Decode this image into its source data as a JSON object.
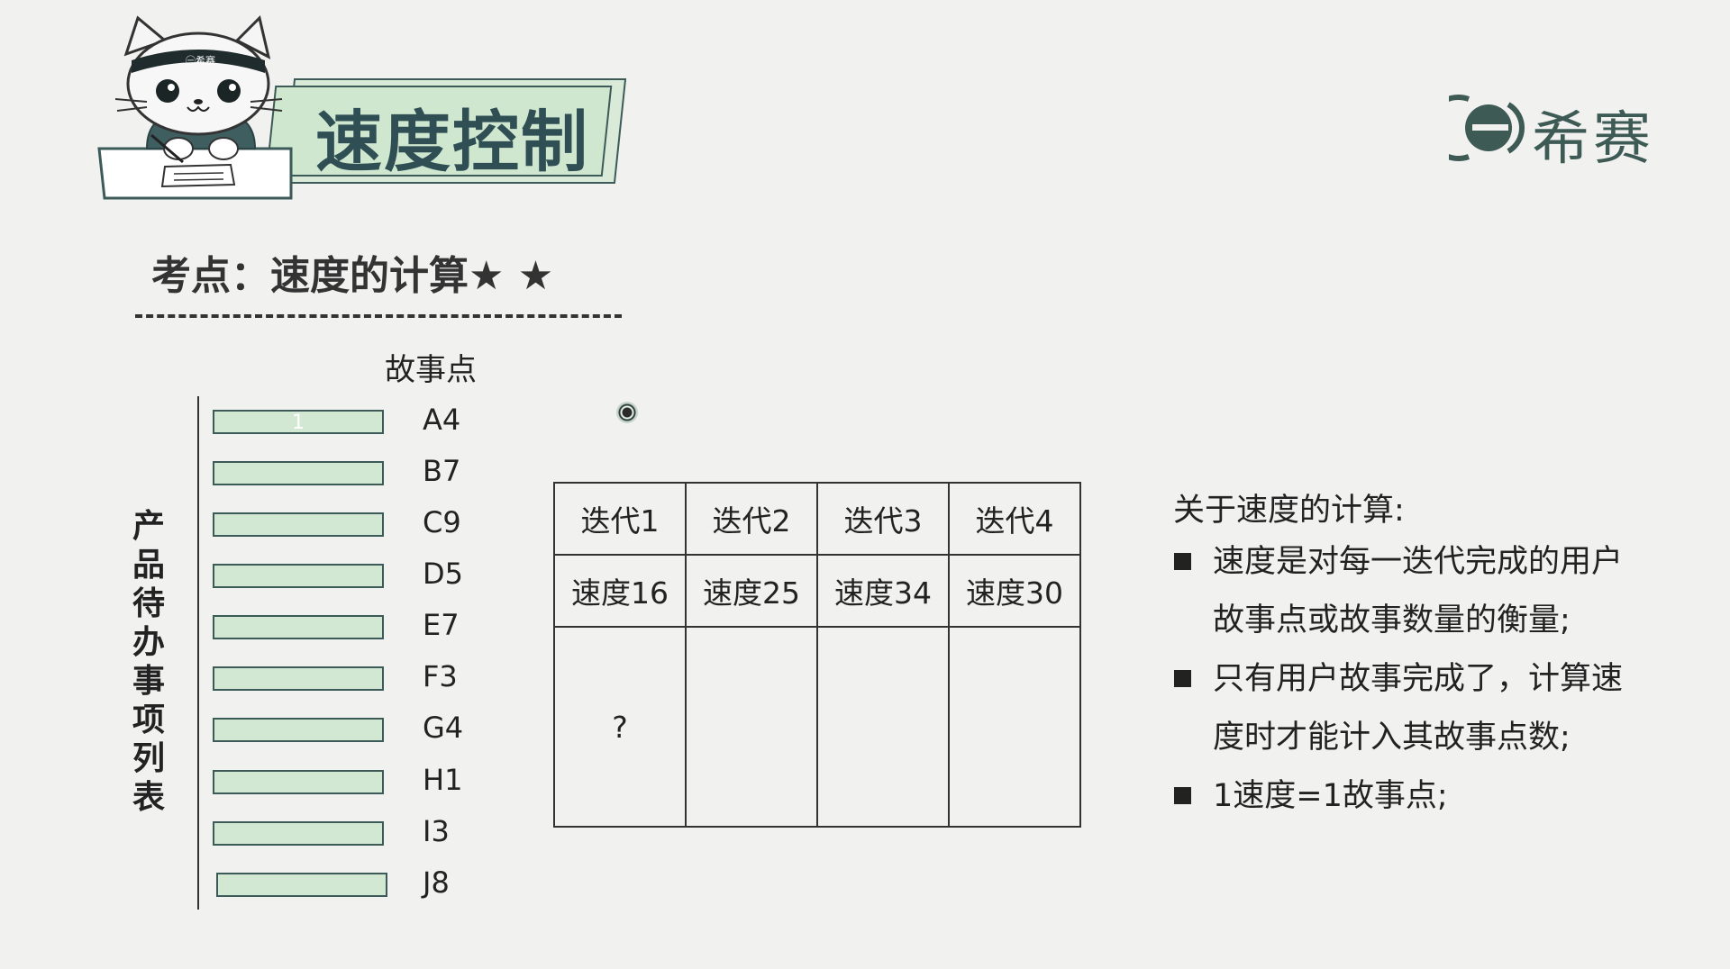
{
  "header": {
    "title": "速度控制",
    "mascot_band_text": "㊀希赛"
  },
  "brand": {
    "name": "希赛",
    "logo_color": "#3d5a55"
  },
  "exam": {
    "heading": "考点：速度的计算★ ★"
  },
  "backlog": {
    "column_label": "故事点",
    "vertical_title": "产品待办事项列表",
    "items": [
      {
        "label": "A4",
        "mark": "1"
      },
      {
        "label": "B7",
        "mark": ""
      },
      {
        "label": "C9",
        "mark": ""
      },
      {
        "label": "D5",
        "mark": ""
      },
      {
        "label": "E7",
        "mark": ""
      },
      {
        "label": "F3",
        "mark": ""
      },
      {
        "label": "G4",
        "mark": ""
      },
      {
        "label": "H1",
        "mark": ""
      },
      {
        "label": "I3",
        "mark": ""
      },
      {
        "label": "J8",
        "mark": ""
      }
    ],
    "bar_color": "#d3e8d2"
  },
  "iterations": {
    "headers": [
      "迭代1",
      "迭代2",
      "迭代3",
      "迭代4"
    ],
    "speeds": [
      "速度16",
      "速度25",
      "速度34",
      "速度30"
    ],
    "contents": [
      "?",
      "",
      "",
      ""
    ]
  },
  "notes": {
    "heading": "关于速度的计算:",
    "items": [
      "速度是对每一迭代完成的用户故事点或故事数量的衡量;",
      "只有用户故事完成了，计算速度时才能计入其故事点数;",
      "1速度=1故事点;"
    ]
  }
}
